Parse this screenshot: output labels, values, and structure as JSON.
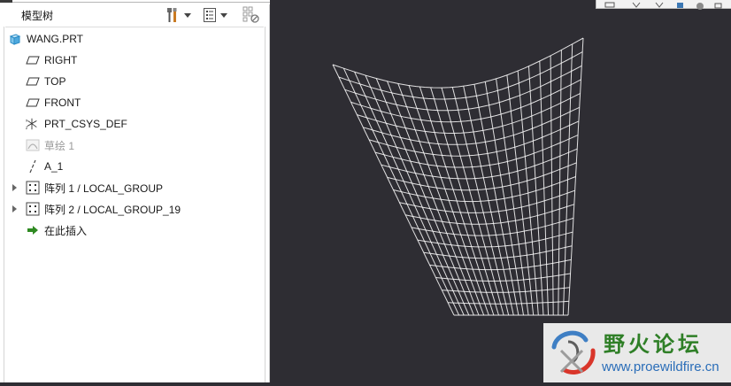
{
  "tree": {
    "title": "模型树",
    "header_icons": [
      "settings-tools-icon",
      "tree-columns-icon",
      "filter-icon"
    ],
    "items": [
      {
        "label": "WANG.PRT",
        "icon": "part-cube-icon",
        "expandable": false,
        "disabled": false
      },
      {
        "label": "RIGHT",
        "icon": "datum-plane-icon",
        "expandable": false,
        "disabled": false
      },
      {
        "label": "TOP",
        "icon": "datum-plane-icon",
        "expandable": false,
        "disabled": false
      },
      {
        "label": "FRONT",
        "icon": "datum-plane-icon",
        "expandable": false,
        "disabled": false
      },
      {
        "label": "PRT_CSYS_DEF",
        "icon": "coordinate-system-icon",
        "expandable": false,
        "disabled": false
      },
      {
        "label": "草绘 1",
        "icon": "sketch-icon",
        "expandable": false,
        "disabled": true
      },
      {
        "label": "A_1",
        "icon": "datum-axis-icon",
        "expandable": false,
        "disabled": false
      },
      {
        "label": "阵列 1 / LOCAL_GROUP",
        "icon": "pattern-icon",
        "expandable": true,
        "disabled": false
      },
      {
        "label": "阵列 2 / LOCAL_GROUP_19",
        "icon": "pattern-icon",
        "expandable": true,
        "disabled": false
      },
      {
        "label": "在此插入",
        "icon": "insert-here-arrow-icon",
        "expandable": false,
        "disabled": false
      }
    ]
  },
  "viewport": {
    "background": "#2e2d33",
    "model": "wireframe-curved-surface-mesh",
    "mesh_color": "#ffffff"
  },
  "watermark": {
    "title": "野火论坛",
    "url": "www.proewildfire.cn",
    "logo": "proewildfire-logo-icon"
  },
  "colors": {
    "accent_green": "#2f7f27",
    "url_blue": "#2a6db8"
  }
}
